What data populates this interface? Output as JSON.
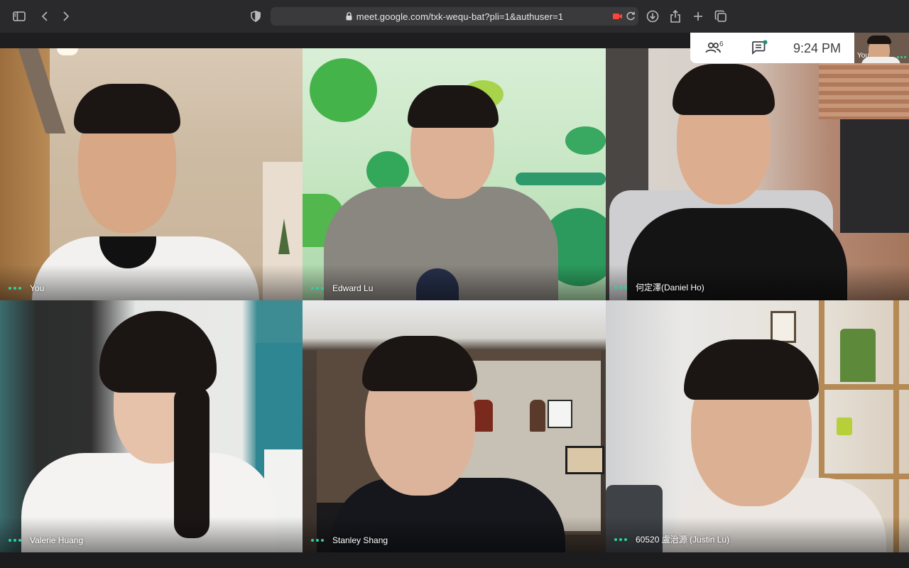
{
  "browser": {
    "url": "meet.google.com/txk-wequ-bat?pli=1&authuser=1",
    "icons": [
      "sidebar-icon",
      "back-icon",
      "forward-icon",
      "shield-icon",
      "lock-icon",
      "camera-icon",
      "reload-icon",
      "download-icon",
      "share-icon",
      "new-tab-icon",
      "tabs-icon"
    ]
  },
  "meet": {
    "participants_count": "6",
    "time": "9:24 PM",
    "self_label": "You",
    "accent_color": "#2ad3a0"
  },
  "tiles": [
    {
      "name": "You"
    },
    {
      "name": "Edward Lu"
    },
    {
      "name": "何定澤(Daniel Ho)"
    },
    {
      "name": "Valerie Huang"
    },
    {
      "name": "Stanley Shang"
    },
    {
      "name": "60520 盧治源 (Justin Lu)"
    }
  ]
}
